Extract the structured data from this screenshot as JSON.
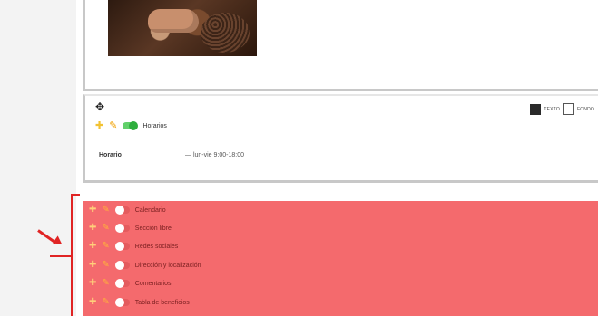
{
  "horario_block": {
    "toggle_label": "Horarios",
    "swatch_text_label": "TEXTO",
    "swatch_bg_label": "FONDO",
    "field_label": "Horario",
    "field_value": "— lun-vie 9:00-18:00"
  },
  "sections": [
    {
      "label": "Calendario"
    },
    {
      "label": "Sección libre"
    },
    {
      "label": "Redes sociales"
    },
    {
      "label": "Dirección y localización"
    },
    {
      "label": "Comentarios"
    },
    {
      "label": "Tabla de beneficios"
    }
  ],
  "colors": {
    "highlight": "#f46a6d",
    "annotation": "#e02424",
    "toggle_on": "#2eae3d"
  },
  "icons": {
    "move": "move-icon",
    "add": "plus-icon",
    "edit": "pencil-icon"
  }
}
